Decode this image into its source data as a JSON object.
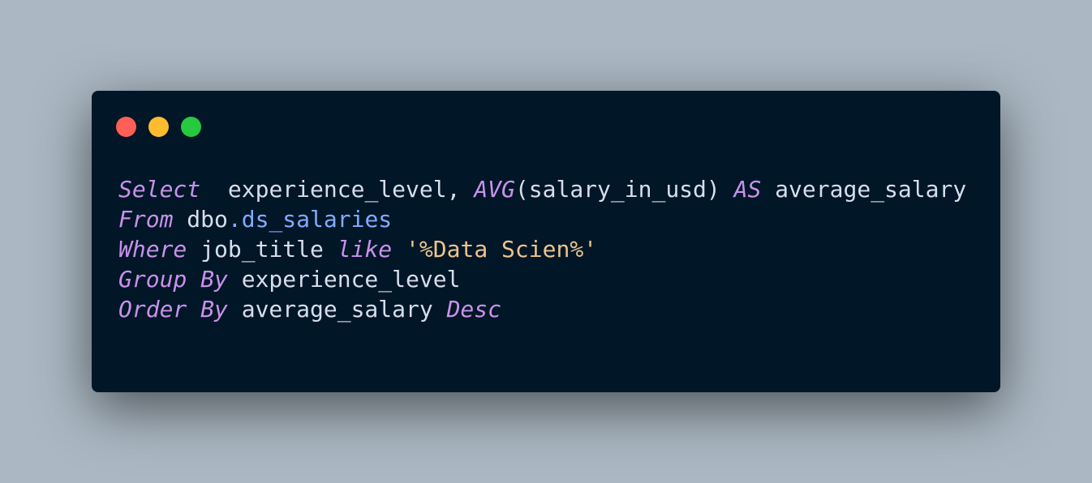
{
  "window": {
    "controls": [
      {
        "name": "close",
        "color": "#ff5f56"
      },
      {
        "name": "minimize",
        "color": "#ffbd2e"
      },
      {
        "name": "maximize",
        "color": "#27c93f"
      }
    ]
  },
  "code": {
    "language": "sql",
    "lines": [
      {
        "tokens": [
          {
            "text": "Select",
            "type": "keyword"
          },
          {
            "text": "  experience_level, ",
            "type": "identifier"
          },
          {
            "text": "AVG",
            "type": "keyword"
          },
          {
            "text": "(salary_in_usd) ",
            "type": "identifier"
          },
          {
            "text": "AS",
            "type": "keyword"
          },
          {
            "text": " average_salary",
            "type": "identifier"
          }
        ]
      },
      {
        "tokens": [
          {
            "text": "From",
            "type": "keyword"
          },
          {
            "text": " dbo",
            "type": "identifier"
          },
          {
            "text": ".ds_salaries",
            "type": "property"
          }
        ]
      },
      {
        "tokens": [
          {
            "text": "Where",
            "type": "keyword"
          },
          {
            "text": " job_title ",
            "type": "identifier"
          },
          {
            "text": "like",
            "type": "keyword"
          },
          {
            "text": " ",
            "type": "identifier"
          },
          {
            "text": "'%Data Scien%'",
            "type": "string"
          }
        ]
      },
      {
        "tokens": [
          {
            "text": "Group By",
            "type": "keyword"
          },
          {
            "text": " experience_level",
            "type": "identifier"
          }
        ]
      },
      {
        "tokens": [
          {
            "text": "Order By",
            "type": "keyword"
          },
          {
            "text": " average_salary ",
            "type": "identifier"
          },
          {
            "text": "Desc",
            "type": "keyword"
          }
        ]
      }
    ]
  }
}
